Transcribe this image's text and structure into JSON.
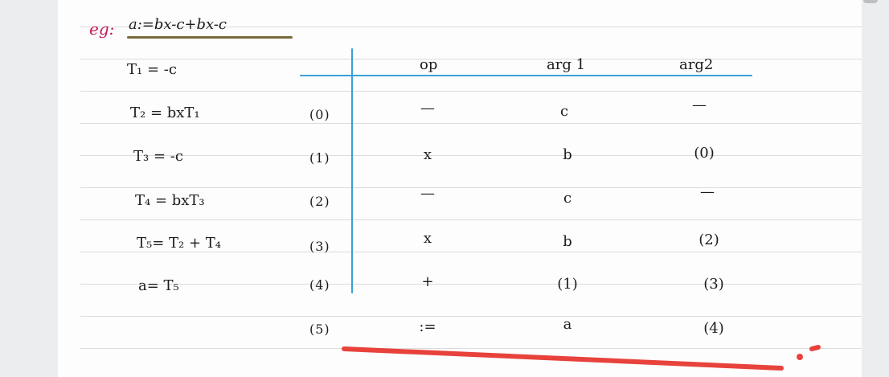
{
  "note": {
    "example_label": "eg:",
    "equation": "a:=bx-c+bx-c"
  },
  "steps": [
    "T₁ = -c",
    "T₂ = bxT₁",
    "T₃ = -c",
    "T₄ = bxT₃",
    "T₅= T₂ + T₄",
    "a= T₅"
  ],
  "table": {
    "headers": [
      "op",
      "arg 1",
      "arg2"
    ],
    "rows": [
      {
        "index": "(0)",
        "op": "—",
        "arg1": "c",
        "arg2": "—"
      },
      {
        "index": "(1)",
        "op": "x",
        "arg1": "b",
        "arg2": "(0)"
      },
      {
        "index": "(2)",
        "op": "—",
        "arg1": "c",
        "arg2": "—"
      },
      {
        "index": "(3)",
        "op": "x",
        "arg1": "b",
        "arg2": "(2)"
      },
      {
        "index": "(4)",
        "op": "+",
        "arg1": "(1)",
        "arg2": "(3)"
      },
      {
        "index": "(5)",
        "op": ":=",
        "arg1": "a",
        "arg2": "(4)"
      }
    ]
  },
  "colors": {
    "paper": "#fdfdfd",
    "rule_line": "#dcdcdc",
    "ink": "#1c1c1c",
    "label_pink": "#c2185b",
    "table_lines": "#3aa0d8",
    "red_stroke": "#e8423c"
  }
}
